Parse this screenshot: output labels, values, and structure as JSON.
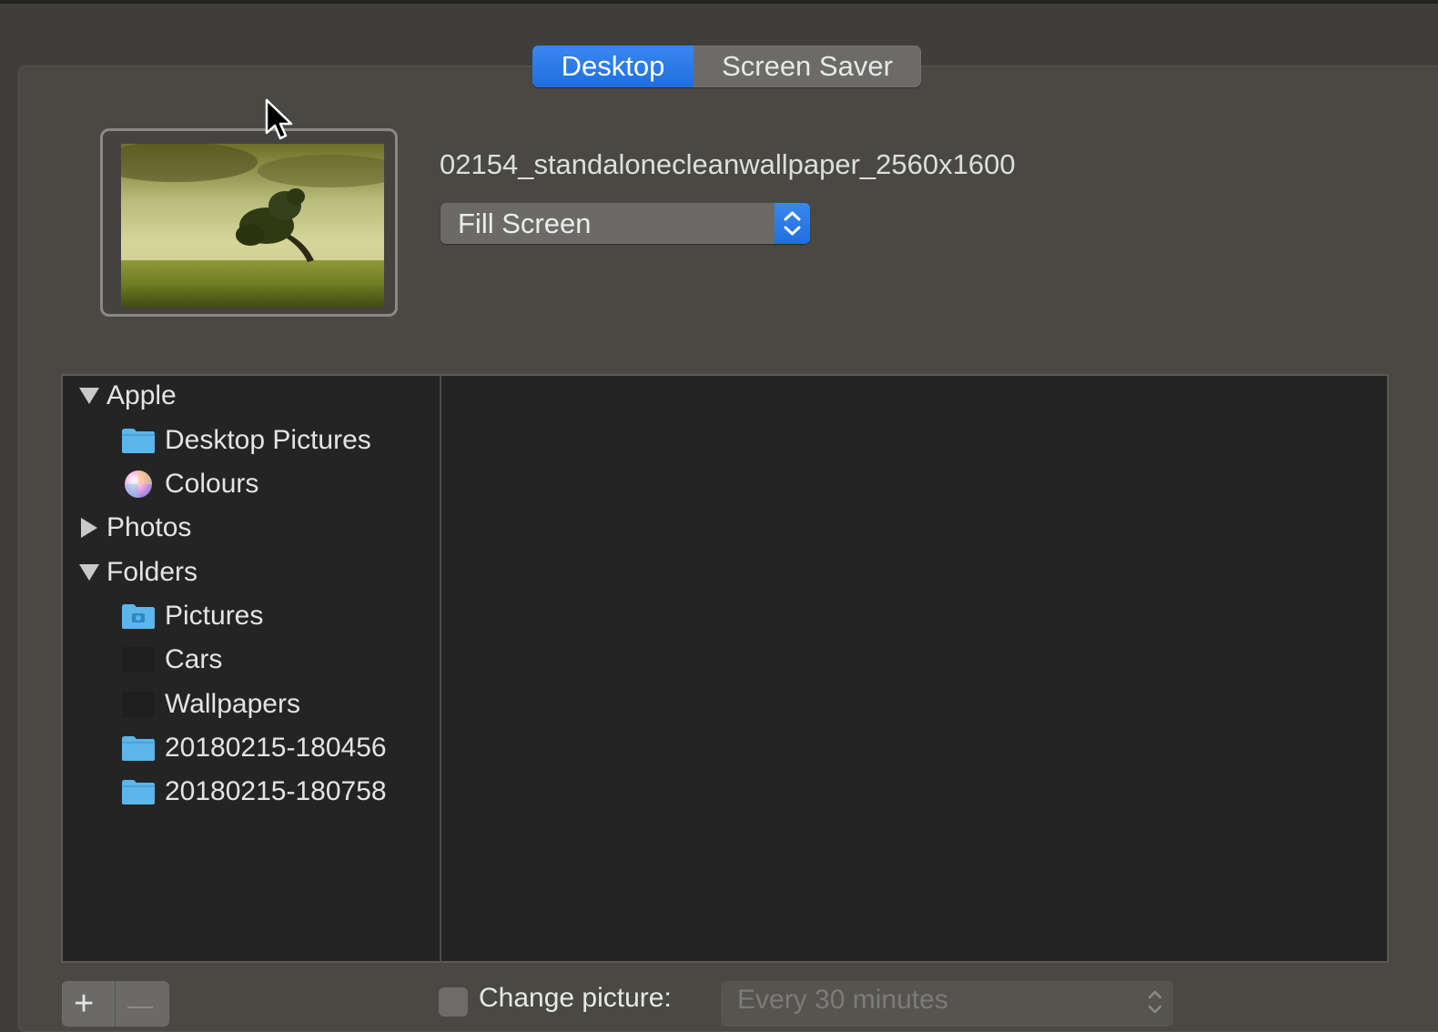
{
  "tabs": [
    {
      "label": "Desktop",
      "active": true
    },
    {
      "label": "Screen Saver",
      "active": false
    }
  ],
  "wallpaper": {
    "filename": "02154_standalonecleanwallpaper_2560x1600",
    "fit_mode": "Fill Screen"
  },
  "sources": {
    "apple": {
      "label": "Apple",
      "expanded": true,
      "items": [
        {
          "label": "Desktop Pictures",
          "icon": "folder-icon"
        },
        {
          "label": "Colours",
          "icon": "color-wheel-icon"
        }
      ]
    },
    "photos": {
      "label": "Photos",
      "expanded": false
    },
    "folders": {
      "label": "Folders",
      "expanded": true,
      "items": [
        {
          "label": "Pictures",
          "icon": "pictures-folder-icon"
        },
        {
          "label": "Cars",
          "icon": "thumbnail-icon"
        },
        {
          "label": "Wallpapers",
          "icon": "thumbnail-icon"
        },
        {
          "label": "20180215-180456",
          "icon": "folder-icon"
        },
        {
          "label": "20180215-180758",
          "icon": "folder-icon"
        }
      ]
    }
  },
  "controls": {
    "add_symbol": "+",
    "remove_symbol": "—",
    "change_picture_label": "Change picture:",
    "change_picture_checked": false,
    "interval_value": "Every 30 minutes"
  },
  "colors": {
    "accent": "#2a7de9",
    "window_bg": "#494843",
    "list_bg": "#242424",
    "folder_blue": "#5cb6ec"
  }
}
